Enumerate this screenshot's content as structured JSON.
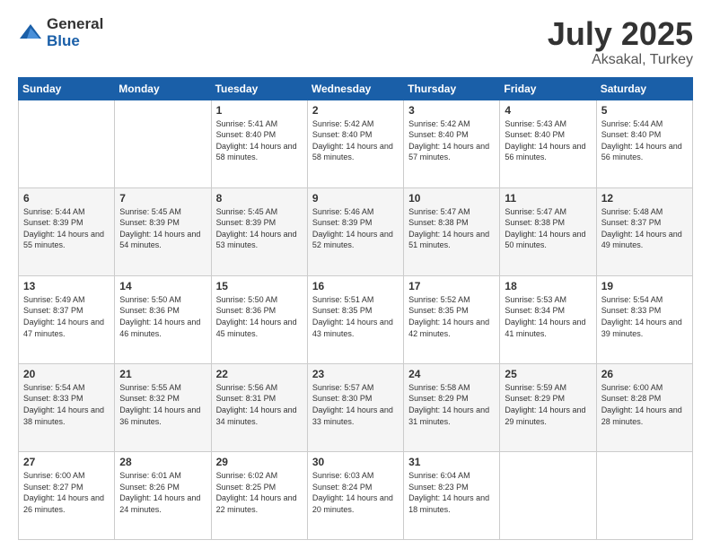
{
  "header": {
    "logo_general": "General",
    "logo_blue": "Blue",
    "month_title": "July 2025",
    "location": "Aksakal, Turkey"
  },
  "days_header": [
    "Sunday",
    "Monday",
    "Tuesday",
    "Wednesday",
    "Thursday",
    "Friday",
    "Saturday"
  ],
  "rows": [
    [
      {
        "day": "",
        "sunrise": "",
        "sunset": "",
        "daylight": ""
      },
      {
        "day": "",
        "sunrise": "",
        "sunset": "",
        "daylight": ""
      },
      {
        "day": "1",
        "sunrise": "Sunrise: 5:41 AM",
        "sunset": "Sunset: 8:40 PM",
        "daylight": "Daylight: 14 hours and 58 minutes."
      },
      {
        "day": "2",
        "sunrise": "Sunrise: 5:42 AM",
        "sunset": "Sunset: 8:40 PM",
        "daylight": "Daylight: 14 hours and 58 minutes."
      },
      {
        "day": "3",
        "sunrise": "Sunrise: 5:42 AM",
        "sunset": "Sunset: 8:40 PM",
        "daylight": "Daylight: 14 hours and 57 minutes."
      },
      {
        "day": "4",
        "sunrise": "Sunrise: 5:43 AM",
        "sunset": "Sunset: 8:40 PM",
        "daylight": "Daylight: 14 hours and 56 minutes."
      },
      {
        "day": "5",
        "sunrise": "Sunrise: 5:44 AM",
        "sunset": "Sunset: 8:40 PM",
        "daylight": "Daylight: 14 hours and 56 minutes."
      }
    ],
    [
      {
        "day": "6",
        "sunrise": "Sunrise: 5:44 AM",
        "sunset": "Sunset: 8:39 PM",
        "daylight": "Daylight: 14 hours and 55 minutes."
      },
      {
        "day": "7",
        "sunrise": "Sunrise: 5:45 AM",
        "sunset": "Sunset: 8:39 PM",
        "daylight": "Daylight: 14 hours and 54 minutes."
      },
      {
        "day": "8",
        "sunrise": "Sunrise: 5:45 AM",
        "sunset": "Sunset: 8:39 PM",
        "daylight": "Daylight: 14 hours and 53 minutes."
      },
      {
        "day": "9",
        "sunrise": "Sunrise: 5:46 AM",
        "sunset": "Sunset: 8:39 PM",
        "daylight": "Daylight: 14 hours and 52 minutes."
      },
      {
        "day": "10",
        "sunrise": "Sunrise: 5:47 AM",
        "sunset": "Sunset: 8:38 PM",
        "daylight": "Daylight: 14 hours and 51 minutes."
      },
      {
        "day": "11",
        "sunrise": "Sunrise: 5:47 AM",
        "sunset": "Sunset: 8:38 PM",
        "daylight": "Daylight: 14 hours and 50 minutes."
      },
      {
        "day": "12",
        "sunrise": "Sunrise: 5:48 AM",
        "sunset": "Sunset: 8:37 PM",
        "daylight": "Daylight: 14 hours and 49 minutes."
      }
    ],
    [
      {
        "day": "13",
        "sunrise": "Sunrise: 5:49 AM",
        "sunset": "Sunset: 8:37 PM",
        "daylight": "Daylight: 14 hours and 47 minutes."
      },
      {
        "day": "14",
        "sunrise": "Sunrise: 5:50 AM",
        "sunset": "Sunset: 8:36 PM",
        "daylight": "Daylight: 14 hours and 46 minutes."
      },
      {
        "day": "15",
        "sunrise": "Sunrise: 5:50 AM",
        "sunset": "Sunset: 8:36 PM",
        "daylight": "Daylight: 14 hours and 45 minutes."
      },
      {
        "day": "16",
        "sunrise": "Sunrise: 5:51 AM",
        "sunset": "Sunset: 8:35 PM",
        "daylight": "Daylight: 14 hours and 43 minutes."
      },
      {
        "day": "17",
        "sunrise": "Sunrise: 5:52 AM",
        "sunset": "Sunset: 8:35 PM",
        "daylight": "Daylight: 14 hours and 42 minutes."
      },
      {
        "day": "18",
        "sunrise": "Sunrise: 5:53 AM",
        "sunset": "Sunset: 8:34 PM",
        "daylight": "Daylight: 14 hours and 41 minutes."
      },
      {
        "day": "19",
        "sunrise": "Sunrise: 5:54 AM",
        "sunset": "Sunset: 8:33 PM",
        "daylight": "Daylight: 14 hours and 39 minutes."
      }
    ],
    [
      {
        "day": "20",
        "sunrise": "Sunrise: 5:54 AM",
        "sunset": "Sunset: 8:33 PM",
        "daylight": "Daylight: 14 hours and 38 minutes."
      },
      {
        "day": "21",
        "sunrise": "Sunrise: 5:55 AM",
        "sunset": "Sunset: 8:32 PM",
        "daylight": "Daylight: 14 hours and 36 minutes."
      },
      {
        "day": "22",
        "sunrise": "Sunrise: 5:56 AM",
        "sunset": "Sunset: 8:31 PM",
        "daylight": "Daylight: 14 hours and 34 minutes."
      },
      {
        "day": "23",
        "sunrise": "Sunrise: 5:57 AM",
        "sunset": "Sunset: 8:30 PM",
        "daylight": "Daylight: 14 hours and 33 minutes."
      },
      {
        "day": "24",
        "sunrise": "Sunrise: 5:58 AM",
        "sunset": "Sunset: 8:29 PM",
        "daylight": "Daylight: 14 hours and 31 minutes."
      },
      {
        "day": "25",
        "sunrise": "Sunrise: 5:59 AM",
        "sunset": "Sunset: 8:29 PM",
        "daylight": "Daylight: 14 hours and 29 minutes."
      },
      {
        "day": "26",
        "sunrise": "Sunrise: 6:00 AM",
        "sunset": "Sunset: 8:28 PM",
        "daylight": "Daylight: 14 hours and 28 minutes."
      }
    ],
    [
      {
        "day": "27",
        "sunrise": "Sunrise: 6:00 AM",
        "sunset": "Sunset: 8:27 PM",
        "daylight": "Daylight: 14 hours and 26 minutes."
      },
      {
        "day": "28",
        "sunrise": "Sunrise: 6:01 AM",
        "sunset": "Sunset: 8:26 PM",
        "daylight": "Daylight: 14 hours and 24 minutes."
      },
      {
        "day": "29",
        "sunrise": "Sunrise: 6:02 AM",
        "sunset": "Sunset: 8:25 PM",
        "daylight": "Daylight: 14 hours and 22 minutes."
      },
      {
        "day": "30",
        "sunrise": "Sunrise: 6:03 AM",
        "sunset": "Sunset: 8:24 PM",
        "daylight": "Daylight: 14 hours and 20 minutes."
      },
      {
        "day": "31",
        "sunrise": "Sunrise: 6:04 AM",
        "sunset": "Sunset: 8:23 PM",
        "daylight": "Daylight: 14 hours and 18 minutes."
      },
      {
        "day": "",
        "sunrise": "",
        "sunset": "",
        "daylight": ""
      },
      {
        "day": "",
        "sunrise": "",
        "sunset": "",
        "daylight": ""
      }
    ]
  ]
}
